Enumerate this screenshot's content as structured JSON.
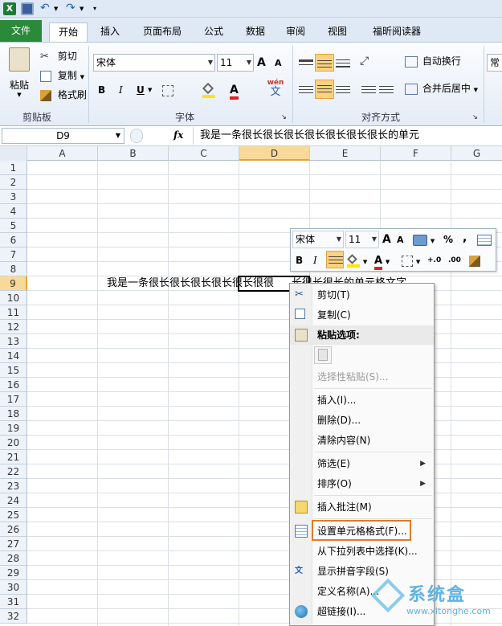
{
  "qat": {
    "undo_label": "↶",
    "redo_label": "↷"
  },
  "tabs": [
    "文件",
    "开始",
    "插入",
    "页面布局",
    "公式",
    "数据",
    "审阅",
    "视图",
    "福昕阅读器"
  ],
  "clipboard": {
    "paste": "粘贴",
    "cut": "剪切",
    "copy": "复制",
    "format_painter": "格式刷",
    "group": "剪贴板"
  },
  "font": {
    "name": "宋体",
    "size": "11",
    "bold": "B",
    "italic": "I",
    "underline": "U",
    "grow": "A",
    "shrink": "A",
    "phonetic": "wén",
    "phonetic_char": "文",
    "group": "字体"
  },
  "alignment": {
    "wrap": "自动换行",
    "merge": "合并后居中",
    "group": "对齐方式",
    "partial_next": "常"
  },
  "formula_bar": {
    "name_box": "D9",
    "fx": "fx",
    "content": "我是一条很长很长很长很长很长很长很长的单元"
  },
  "columns": [
    "A",
    "B",
    "C",
    "D",
    "E",
    "F",
    "G"
  ],
  "rows": [
    "1",
    "2",
    "3",
    "4",
    "5",
    "6",
    "7",
    "8",
    "9",
    "10",
    "11",
    "12",
    "13",
    "14",
    "15",
    "16",
    "17",
    "18",
    "19",
    "20",
    "21",
    "22",
    "23",
    "24",
    "25",
    "26",
    "27",
    "28",
    "29",
    "30",
    "31",
    "32"
  ],
  "cell_text": {
    "left": "我是一条很长很长很长很",
    "selected": "长很长很",
    "mid": "很",
    "right": "长很长很长的单元格文字"
  },
  "mini_toolbar": {
    "font": "宋体",
    "size": "11",
    "percent": "%",
    "comma": ",",
    "bold": "B",
    "italic": "I",
    "dec_inc": "+.0",
    "dec_dec": ".00"
  },
  "context_menu": {
    "cut": "剪切(T)",
    "copy": "复制(C)",
    "paste_options": "粘贴选项:",
    "paste_special": "选择性粘贴(S)...",
    "insert": "插入(I)...",
    "delete": "删除(D)...",
    "clear": "清除内容(N)",
    "filter": "筛选(E)",
    "sort": "排序(O)",
    "insert_comment": "插入批注(M)",
    "format_cells": "设置单元格格式(F)...",
    "pick_list": "从下拉列表中选择(K)...",
    "phonetic": "显示拼音字段(S)",
    "define_name": "定义名称(A)...",
    "hyperlink": "超链接(I)..."
  },
  "watermark": {
    "text": "系统盒",
    "url": "www.xitonghe.com"
  },
  "colors": {
    "file_tab": "#2a8a3a",
    "highlight_box": "#e07b2c",
    "selected_col": "#f9d99a",
    "ribbon_bg": "#dfe9f5"
  }
}
